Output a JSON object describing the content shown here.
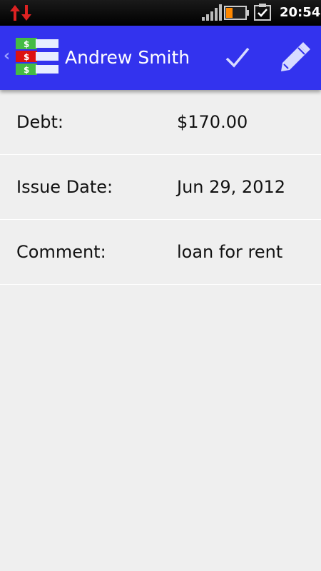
{
  "status_bar": {
    "time": "20:54",
    "icons": [
      "data-transfer-arrows-icon",
      "signal-strength-icon",
      "battery-low-icon",
      "checkbox-notification-icon"
    ],
    "arrow_color": "#dd2222"
  },
  "action_bar": {
    "title": "Andrew Smith",
    "background": "#3333ee",
    "actions": [
      "checkmark-icon",
      "pencil-icon"
    ]
  },
  "details": [
    {
      "label": "Debt:",
      "value": "$170.00"
    },
    {
      "label": "Issue Date:",
      "value": "Jun 29, 2012"
    },
    {
      "label": "Comment:",
      "value": "loan for rent"
    }
  ],
  "logo": {
    "symbols": [
      "$",
      "$",
      "$"
    ]
  }
}
